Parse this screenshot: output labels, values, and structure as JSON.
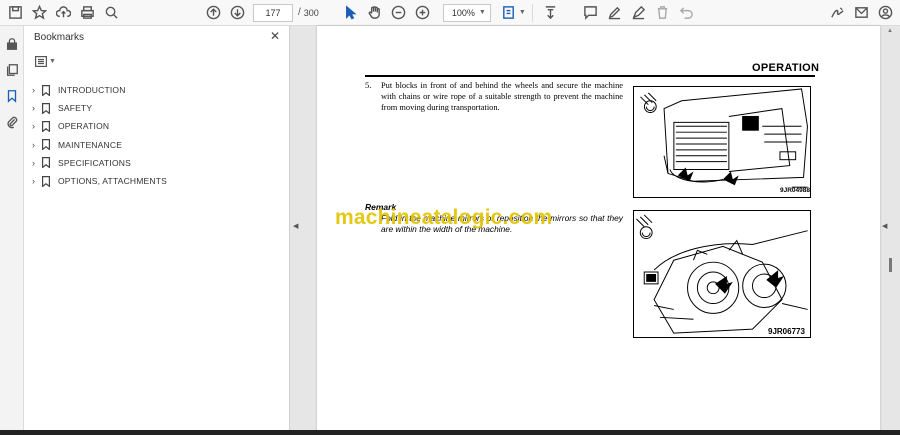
{
  "toolbar": {
    "page_current": "177",
    "page_total": "300",
    "zoom": "100%"
  },
  "panel": {
    "title": "Bookmarks",
    "bookmarks": [
      {
        "label": "INTRODUCTION"
      },
      {
        "label": "SAFETY"
      },
      {
        "label": "OPERATION"
      },
      {
        "label": "MAINTENANCE"
      },
      {
        "label": "SPECIFICATIONS"
      },
      {
        "label": "OPTIONS, ATTACHMENTS"
      }
    ]
  },
  "document": {
    "section_title": "OPERATION",
    "step_number": "5.",
    "step_text": "Put blocks in front of and behind the wheels and secure the machine with chains or wire rope of a suitable strength to prevent the machine from moving during transportation.",
    "remark_heading": "Remark",
    "remark_text": "Fold in the machine mirrors or reposition the mirrors so that they are within the width of the machine.",
    "watermark": "machineatalogic.com",
    "figure1_caption": "9JR04988",
    "figure2_caption": "9JR06773"
  },
  "colors": {
    "watermark": "#e3c400",
    "toolbar_bg": "#f8f8f8",
    "doc_bg": "#e6e6e6"
  }
}
